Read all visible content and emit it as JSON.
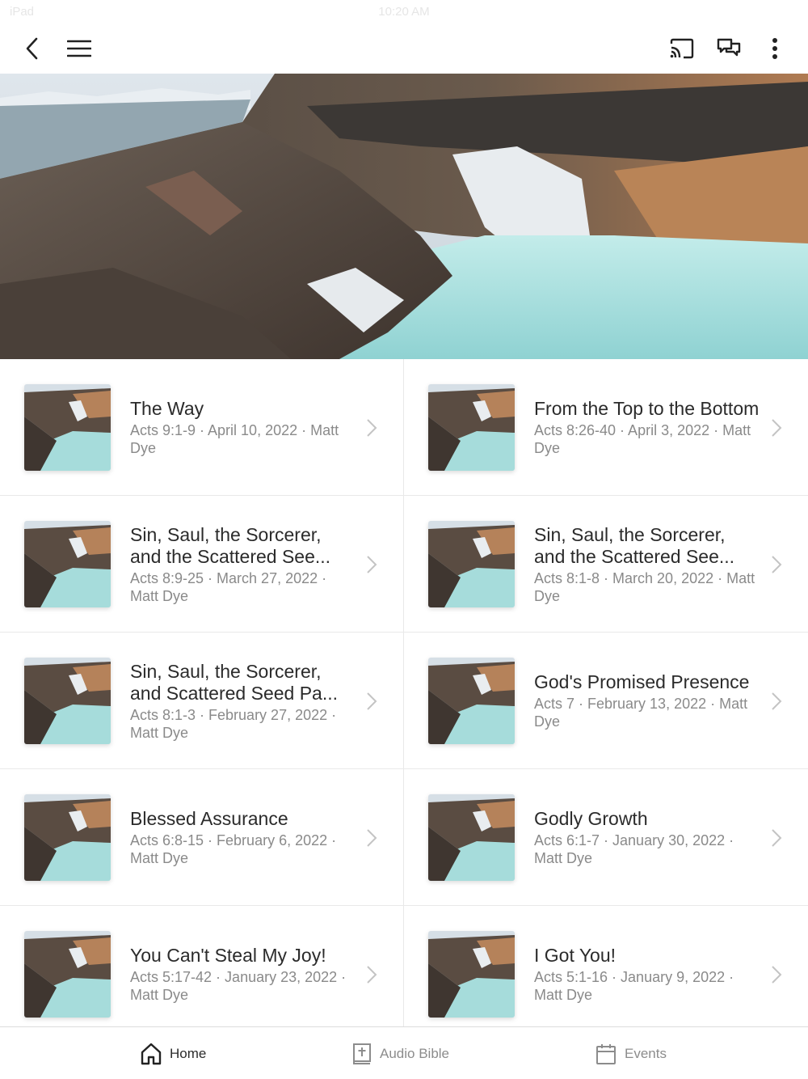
{
  "status": {
    "device": "iPad",
    "time": "10:20 AM"
  },
  "header": {
    "icons": [
      "back-icon",
      "menu-icon",
      "cast-icon",
      "chat-icon",
      "more-icon"
    ]
  },
  "sermons": [
    {
      "title": "The Way",
      "meta": "Acts 9:1-9 · April 10, 2022 · Matt Dye"
    },
    {
      "title": "From the Top to the Bottom",
      "meta": "Acts 8:26-40 · April 3, 2022 · Matt Dye"
    },
    {
      "title": "Sin, Saul, the Sorcerer, and the Scattered See...",
      "meta": "Acts 8:9-25 · March 27, 2022 · Matt Dye"
    },
    {
      "title": "Sin, Saul, the Sorcerer, and the Scattered See...",
      "meta": "Acts 8:1-8 · March 20, 2022 · Matt Dye"
    },
    {
      "title": "Sin, Saul, the Sorcerer, and Scattered Seed Pa...",
      "meta": "Acts 8:1-3 · February 27, 2022 · Matt Dye"
    },
    {
      "title": "God's Promised Presence",
      "meta": "Acts 7 · February 13, 2022 · Matt Dye"
    },
    {
      "title": "Blessed Assurance",
      "meta": "Acts 6:8-15 · February 6, 2022 · Matt Dye"
    },
    {
      "title": "Godly Growth",
      "meta": "Acts 6:1-7 · January 30, 2022 · Matt Dye"
    },
    {
      "title": "You Can't Steal My Joy!",
      "meta": "Acts 5:17-42 · January 23, 2022 · Matt Dye"
    },
    {
      "title": "I Got You!",
      "meta": "Acts 5:1-16 · January 9, 2022 · Matt Dye"
    }
  ],
  "nav": {
    "home": "Home",
    "audio_bible": "Audio Bible",
    "events": "Events"
  },
  "colors": {
    "lake": "#a8dedd",
    "rock": "#5b4d44",
    "accent_inactive": "#8c8c8c"
  }
}
